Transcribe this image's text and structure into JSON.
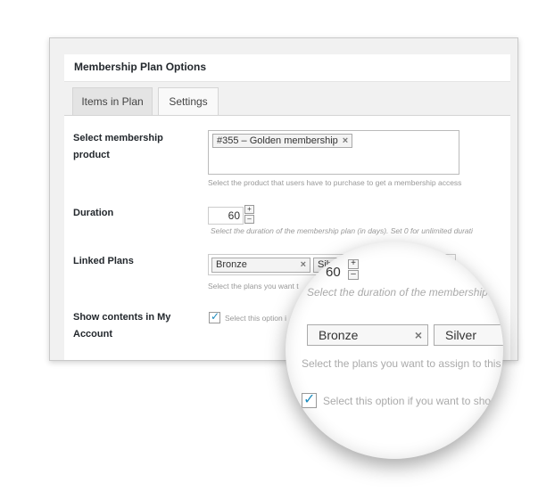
{
  "panel": {
    "title": "Membership Plan Options",
    "tabs": [
      {
        "label": "Items in Plan",
        "active": false
      },
      {
        "label": "Settings",
        "active": true
      }
    ]
  },
  "fields": {
    "product": {
      "label_line1": "Select membership",
      "label_line2": "product",
      "token": "#355 – Golden membership",
      "token_remove": "×",
      "help": "Select the product that users have to purchase to get a membership access"
    },
    "duration": {
      "label": "Duration",
      "value": "60",
      "inc": "+",
      "dec": "–",
      "help": "Select the duration of the membership plan (in days). Set 0 for unlimited durati"
    },
    "linked": {
      "label": "Linked Plans",
      "tokens": [
        "Bronze",
        "Silv"
      ],
      "token_remove": "×",
      "help": "Select the plans you want t"
    },
    "show": {
      "label_line1": "Show contents in My",
      "label_line2": "Account",
      "checked": true,
      "help": "Select this option i"
    }
  },
  "magnifier": {
    "duration_value": "60",
    "inc": "+",
    "dec": "–",
    "duration_help": "Select the duration of the membership",
    "tokens": [
      "Bronze",
      "Silver"
    ],
    "token_remove": "×",
    "linked_help": "Select the plans you want to assign to this",
    "show_help": "Select this option if you want to sho"
  },
  "colors": {
    "accent": "#1e8cbe",
    "panel_bg": "#f1f1f1",
    "border": "#c9c9c9"
  }
}
